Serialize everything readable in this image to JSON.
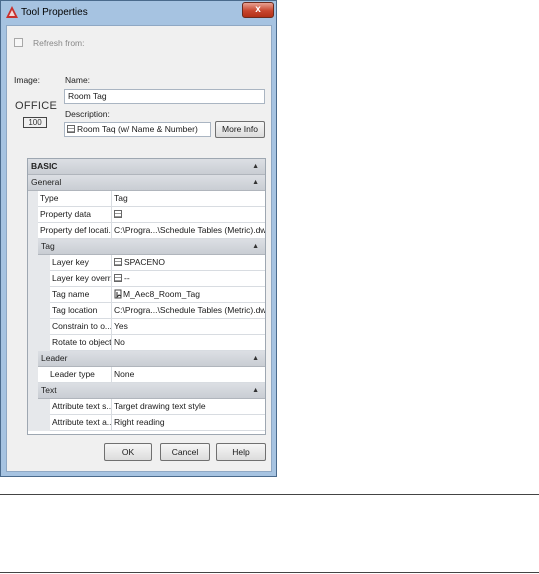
{
  "window": {
    "title": "Tool Properties",
    "close_label": "x"
  },
  "refresh": {
    "label": "Refresh from:"
  },
  "image": {
    "label": "Image:",
    "office_text": "OFFICE",
    "office_number": "100"
  },
  "name": {
    "label": "Name:",
    "value": "Room Tag"
  },
  "description": {
    "label": "Description:",
    "value": "Room Taq (w/ Name & Number)"
  },
  "more_info_button": "More Info",
  "grid": {
    "basic": "BASIC",
    "general": "General",
    "type": {
      "name": "Type",
      "value": "Tag"
    },
    "property_data": {
      "name": "Property data",
      "value": ""
    },
    "property_def_location": {
      "name": "Property def locati...",
      "value": "C:\\Progra...\\Schedule Tables (Metric).dwg"
    },
    "tag_section": "Tag",
    "layer_key": {
      "name": "Layer key",
      "value": "SPACENO"
    },
    "layer_key_overrides": {
      "name": "Layer key overr...",
      "value": "--"
    },
    "tag_name": {
      "name": "Tag name",
      "value": "M_Aec8_Room_Tag"
    },
    "tag_location": {
      "name": "Tag location",
      "value": "C:\\Progra...\\Schedule Tables (Metric).dwg"
    },
    "constrain": {
      "name": "Constrain to o...",
      "value": "Yes"
    },
    "rotate": {
      "name": "Rotate to object",
      "value": "No"
    },
    "leader_section": "Leader",
    "leader_type": {
      "name": "Leader type",
      "value": "None"
    },
    "text_section": "Text",
    "attr_text_style": {
      "name": "Attribute text s...",
      "value": "Target drawing text style"
    },
    "attr_text_angle": {
      "name": "Attribute text a...",
      "value": "Right reading"
    }
  },
  "buttons": {
    "ok": "OK",
    "cancel": "Cancel",
    "help": "Help"
  },
  "icons": {
    "title": "autocad-icon",
    "collapse": "collapse-arrow-icon"
  }
}
